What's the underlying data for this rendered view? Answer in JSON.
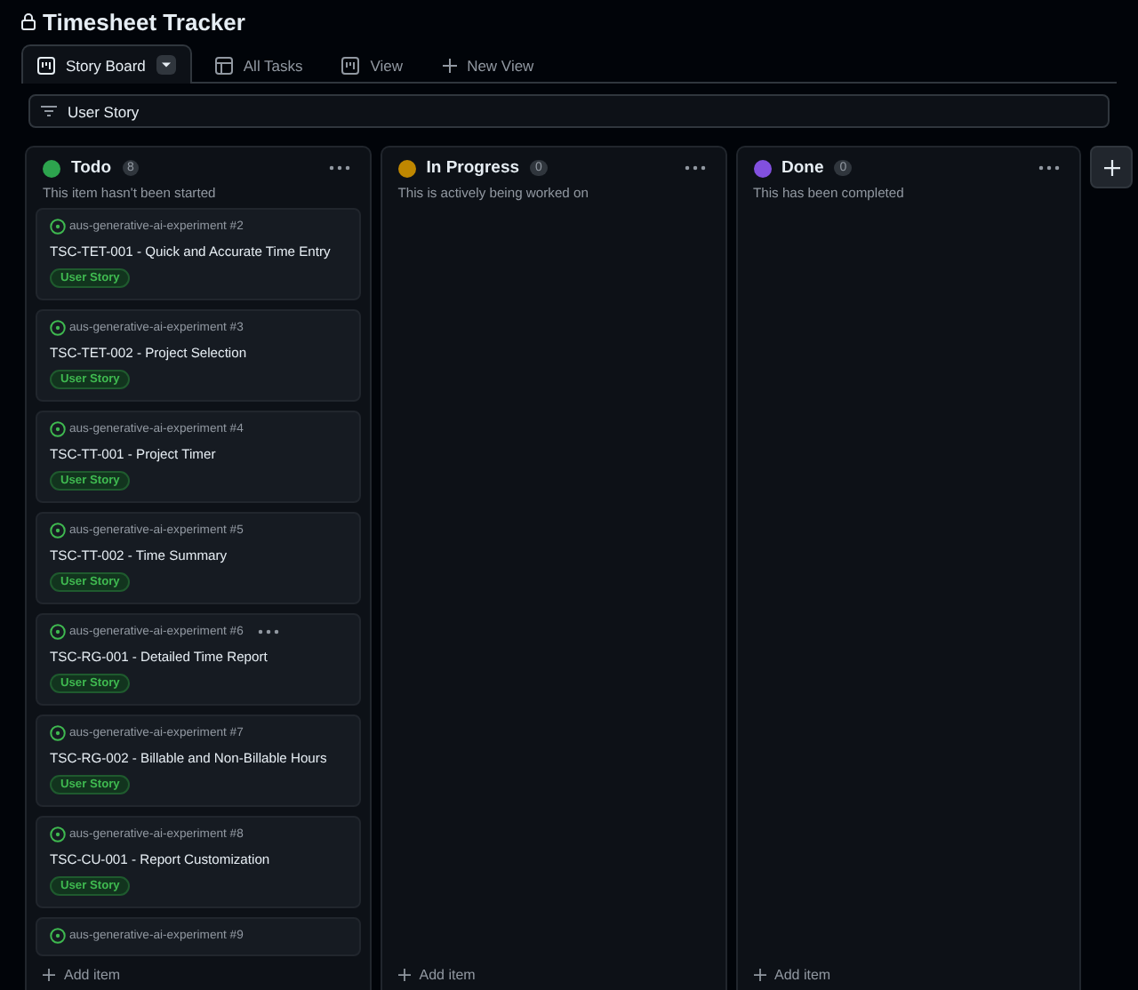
{
  "window": {
    "title": "Timesheet Tracker"
  },
  "tabs": [
    {
      "label": "Story Board",
      "kind": "board",
      "selected": true
    },
    {
      "label": "All Tasks",
      "kind": "table",
      "selected": false
    },
    {
      "label": "View",
      "kind": "board",
      "selected": false
    },
    {
      "label": "New View",
      "kind": "new",
      "selected": false
    }
  ],
  "filter": {
    "label": "User Story"
  },
  "columns": [
    {
      "name": "Todo",
      "count": "8",
      "color": "#2da44e",
      "description": "This item hasn't been started",
      "add_label": "Add item",
      "cards": [
        {
          "repo": "aus-generative-ai-experiment #2",
          "title": "TSC-TET-001 - Quick and Accurate Time Entry",
          "label": "User Story",
          "menu_visible": false
        },
        {
          "repo": "aus-generative-ai-experiment #3",
          "title": "TSC-TET-002 - Project Selection",
          "label": "User Story",
          "menu_visible": false
        },
        {
          "repo": "aus-generative-ai-experiment #4",
          "title": "TSC-TT-001 - Project Timer",
          "label": "User Story",
          "menu_visible": false
        },
        {
          "repo": "aus-generative-ai-experiment #5",
          "title": "TSC-TT-002 - Time Summary",
          "label": "User Story",
          "menu_visible": false
        },
        {
          "repo": "aus-generative-ai-experiment #6",
          "title": "TSC-RG-001 - Detailed Time Report",
          "label": "User Story",
          "menu_visible": true
        },
        {
          "repo": "aus-generative-ai-experiment #7",
          "title": "TSC-RG-002 - Billable and Non-Billable Hours",
          "label": "User Story",
          "menu_visible": false
        },
        {
          "repo": "aus-generative-ai-experiment #8",
          "title": "TSC-CU-001 - Report Customization",
          "label": "User Story",
          "menu_visible": false
        },
        {
          "repo": "aus-generative-ai-experiment #9",
          "menu_visible": false
        }
      ]
    },
    {
      "name": "In Progress",
      "count": "0",
      "color": "#bf8700",
      "description": "This is actively being worked on",
      "add_label": "Add item"
    },
    {
      "name": "Done",
      "count": "0",
      "color": "#8250df",
      "description": "This has been completed",
      "add_label": "Add item"
    }
  ]
}
